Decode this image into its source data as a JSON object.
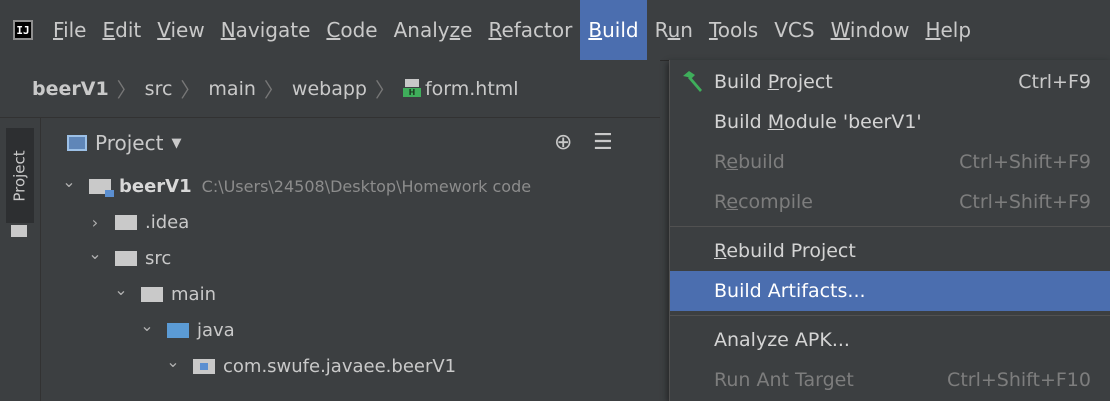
{
  "menubar": {
    "items": [
      {
        "label": "File",
        "u": 0
      },
      {
        "label": "Edit",
        "u": 0
      },
      {
        "label": "View",
        "u": 0
      },
      {
        "label": "Navigate",
        "u": 0
      },
      {
        "label": "Code",
        "u": 0
      },
      {
        "label": "Analyze",
        "u": 5
      },
      {
        "label": "Refactor",
        "u": 0
      },
      {
        "label": "Build",
        "u": 0,
        "active": true
      },
      {
        "label": "Run",
        "u": 1
      },
      {
        "label": "Tools",
        "u": 0
      },
      {
        "label": "VCS",
        "u": -1
      },
      {
        "label": "Window",
        "u": 0
      },
      {
        "label": "Help",
        "u": 0
      }
    ]
  },
  "breadcrumb": {
    "items": [
      "beerV1",
      "src",
      "main",
      "webapp",
      "form.html"
    ]
  },
  "toolstrip": {
    "project_tab": "Project"
  },
  "panel": {
    "title": "Project"
  },
  "tree": [
    {
      "label": "beerV1",
      "path": "C:\\Users\\24508\\Desktop\\Homework code",
      "bold": true,
      "indent": 0,
      "chev": "down",
      "icon": "module"
    },
    {
      "label": ".idea",
      "indent": 1,
      "chev": "right",
      "icon": "folder"
    },
    {
      "label": "src",
      "indent": 1,
      "chev": "down",
      "icon": "folder"
    },
    {
      "label": "main",
      "indent": 2,
      "chev": "down",
      "icon": "folder"
    },
    {
      "label": "java",
      "indent": 3,
      "chev": "down",
      "icon": "blue"
    },
    {
      "label": "com.swufe.javaee.beerV1",
      "indent": 4,
      "chev": "down",
      "icon": "pkg"
    }
  ],
  "build_menu": {
    "items": [
      {
        "label": "Build Project",
        "u": 6,
        "shortcut": "Ctrl+F9",
        "icon": "hammer",
        "disabled": false
      },
      {
        "label": "Build Module 'beerV1'",
        "u": 6,
        "shortcut": "",
        "disabled": false
      },
      {
        "label": "Rebuild",
        "u": 1,
        "shortcut": "Ctrl+Shift+F9",
        "disabled": true
      },
      {
        "label": "Recompile",
        "u": 1,
        "shortcut": "Ctrl+Shift+F9",
        "disabled": true
      },
      {
        "label": "Rebuild Project",
        "u": 0,
        "shortcut": "",
        "disabled": false,
        "sep_before": true
      },
      {
        "label": "Build Artifacts...",
        "u": -1,
        "shortcut": "",
        "disabled": false,
        "selected": true
      },
      {
        "label": "Analyze APK...",
        "u": -1,
        "shortcut": "",
        "disabled": false,
        "sep_before": true
      },
      {
        "label": "Run Ant Target",
        "u": -1,
        "shortcut": "Ctrl+Shift+F10",
        "disabled": true
      }
    ]
  },
  "colors": {
    "accent": "#4b6eaf",
    "hammer": "#3fae5b"
  }
}
